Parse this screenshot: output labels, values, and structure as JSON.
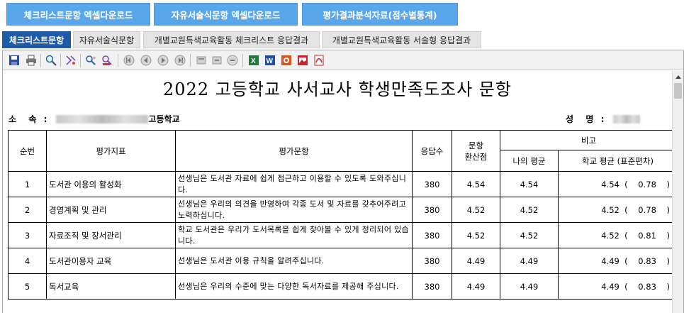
{
  "top_buttons": {
    "checklist_excel": "체크리스트문항 엑셀다운로드",
    "freetext_excel": "자유서술식문항 엑셀다운로드",
    "analysis": "평가결과분석자료(점수별통계)"
  },
  "tabs": [
    {
      "label": "체크리스트문항",
      "active": true
    },
    {
      "label": "자유서술식문항",
      "active": false
    },
    {
      "label": "개별교원특색교육활동 체크리스트 응답결과",
      "active": false
    },
    {
      "label": "개별교원특색교육활동 서술형 응답결과",
      "active": false
    }
  ],
  "toolbar_icons": [
    "save-icon",
    "print-icon",
    "zoom-icon",
    "page-setup-icon",
    "search-icon",
    "search-next-icon",
    "first-page-icon",
    "prev-page-icon",
    "next-page-icon",
    "last-page-icon",
    "export-icon",
    "export2-icon",
    "stop-icon",
    "excel-icon",
    "word-icon",
    "ppt-icon",
    "image-icon",
    "pdf-icon"
  ],
  "report": {
    "title": "2022 고등학교 사서교사 학생만족도조사 문항",
    "affiliation_label": "소  속 :",
    "affiliation_value": "고등학교",
    "name_label": "성  명 :",
    "headers": {
      "no": "순번",
      "indicator": "평가지표",
      "question": "평가문항",
      "responses": "응답수",
      "score": "문항\n환산점",
      "note": "비고",
      "my_avg": "나의 평균",
      "school_avg": "학교 평균 (표준편차)"
    },
    "rows": [
      {
        "no": "1",
        "indicator": "도서관 이용의 활성화",
        "question": "선생님은 도서관 자료에 쉽게 접근하고 이용할 수 있도록 도와주십니다.",
        "responses": "380",
        "score": "4.54",
        "my_avg": "4.54",
        "school_avg": "4.54  (    0.78    )"
      },
      {
        "no": "2",
        "indicator": "경영계획 및 관리",
        "question": "선생님은 우리의 의견을 반영하여 각종 도서 및 자료를 갖추어주려고 노력하십니다.",
        "responses": "380",
        "score": "4.52",
        "my_avg": "4.52",
        "school_avg": "4.52  (    0.78    )"
      },
      {
        "no": "3",
        "indicator": "자료조직 및 장서관리",
        "question": "학교 도서관은 우리가 도서목록을 쉽게 찾아볼 수 있게 정리되어 있습니다.",
        "responses": "380",
        "score": "4.52",
        "my_avg": "4.52",
        "school_avg": "4.52  (    0.81    )"
      },
      {
        "no": "4",
        "indicator": "도서관이용자 교육",
        "question": "선생님은 도서관 이용 규칙을 알려주십니다.",
        "responses": "380",
        "score": "4.49",
        "my_avg": "4.49",
        "school_avg": "4.49  (    0.83    )"
      },
      {
        "no": "5",
        "indicator": "독서교육",
        "question": "선생님은 우리의 수준에 맞는 다양한 독서자료를 제공해 주십니다.",
        "responses": "380",
        "score": "4.49",
        "my_avg": "4.49",
        "school_avg": "4.49  (    0.83    )"
      }
    ]
  }
}
